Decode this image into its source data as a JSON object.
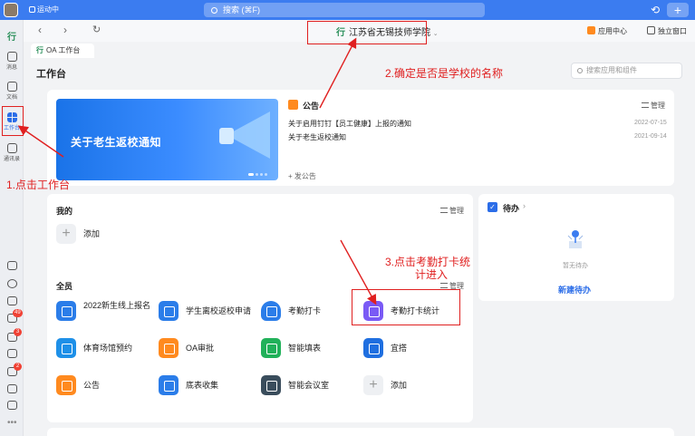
{
  "titlebar": {
    "status": "运动中",
    "search_placeholder": "搜索 (⌘F)"
  },
  "rail": {
    "items": [
      {
        "label": "消息",
        "icon": "message-icon"
      },
      {
        "label": "文档",
        "icon": "doc-icon"
      },
      {
        "label": "工作台",
        "icon": "workbench-icon"
      },
      {
        "label": "通讯录",
        "icon": "contacts-icon"
      }
    ],
    "badges": [
      "49",
      "3",
      "2"
    ]
  },
  "toolbar": {
    "org_name": "江苏省无锡技师学院",
    "app_center": "应用中心",
    "standalone_window": "独立窗口"
  },
  "tab": {
    "label": "OA 工作台"
  },
  "workbench": {
    "title": "工作台",
    "search_placeholder": "搜索应用和组件",
    "banner_text": "关于老生返校通知",
    "notice": {
      "title": "公告",
      "manage": "管理",
      "items": [
        {
          "text": "关于启用钉钉【员工健康】上报的通知",
          "date": "2022-07-15"
        },
        {
          "text": "关于老生返校通知",
          "date": "2021-09-14"
        }
      ],
      "post": "+ 发公告"
    },
    "mine": {
      "label": "我的",
      "manage": "管理",
      "add": "添加"
    },
    "all": {
      "label": "全员",
      "manage": "管理",
      "apps": [
        {
          "label": "2022新生线上报名",
          "color": "#2b7de9"
        },
        {
          "label": "学生离校返校申请",
          "color": "#2b7de9"
        },
        {
          "label": "考勤打卡",
          "color": "#2b7de9"
        },
        {
          "label": "考勤打卡统计",
          "color": "#7a5af5"
        },
        {
          "label": "体育场馆预约",
          "color": "#1e90e8"
        },
        {
          "label": "OA审批",
          "color": "#ff8a1f"
        },
        {
          "label": "智能填表",
          "color": "#21b15a"
        },
        {
          "label": "宜搭",
          "color": "#1f6fe0"
        },
        {
          "label": "公告",
          "color": "#ff8a1f"
        },
        {
          "label": "底表收集",
          "color": "#2b7de9"
        },
        {
          "label": "智能会议室",
          "color": "#3a4d5c"
        },
        {
          "label": "添加",
          "color": "#eef0f3"
        }
      ]
    }
  },
  "todo": {
    "title": "待办",
    "empty": "暂无待办",
    "new": "新建待办"
  },
  "annotations": {
    "step1": "1.点击工作台",
    "step2": "2.确定是否是学校的名称",
    "step3_line1": "3.点击考勤打卡统",
    "step3_line2": "计进入"
  },
  "colors": {
    "accent": "#3b7cf0",
    "annotation": "#e02020"
  }
}
